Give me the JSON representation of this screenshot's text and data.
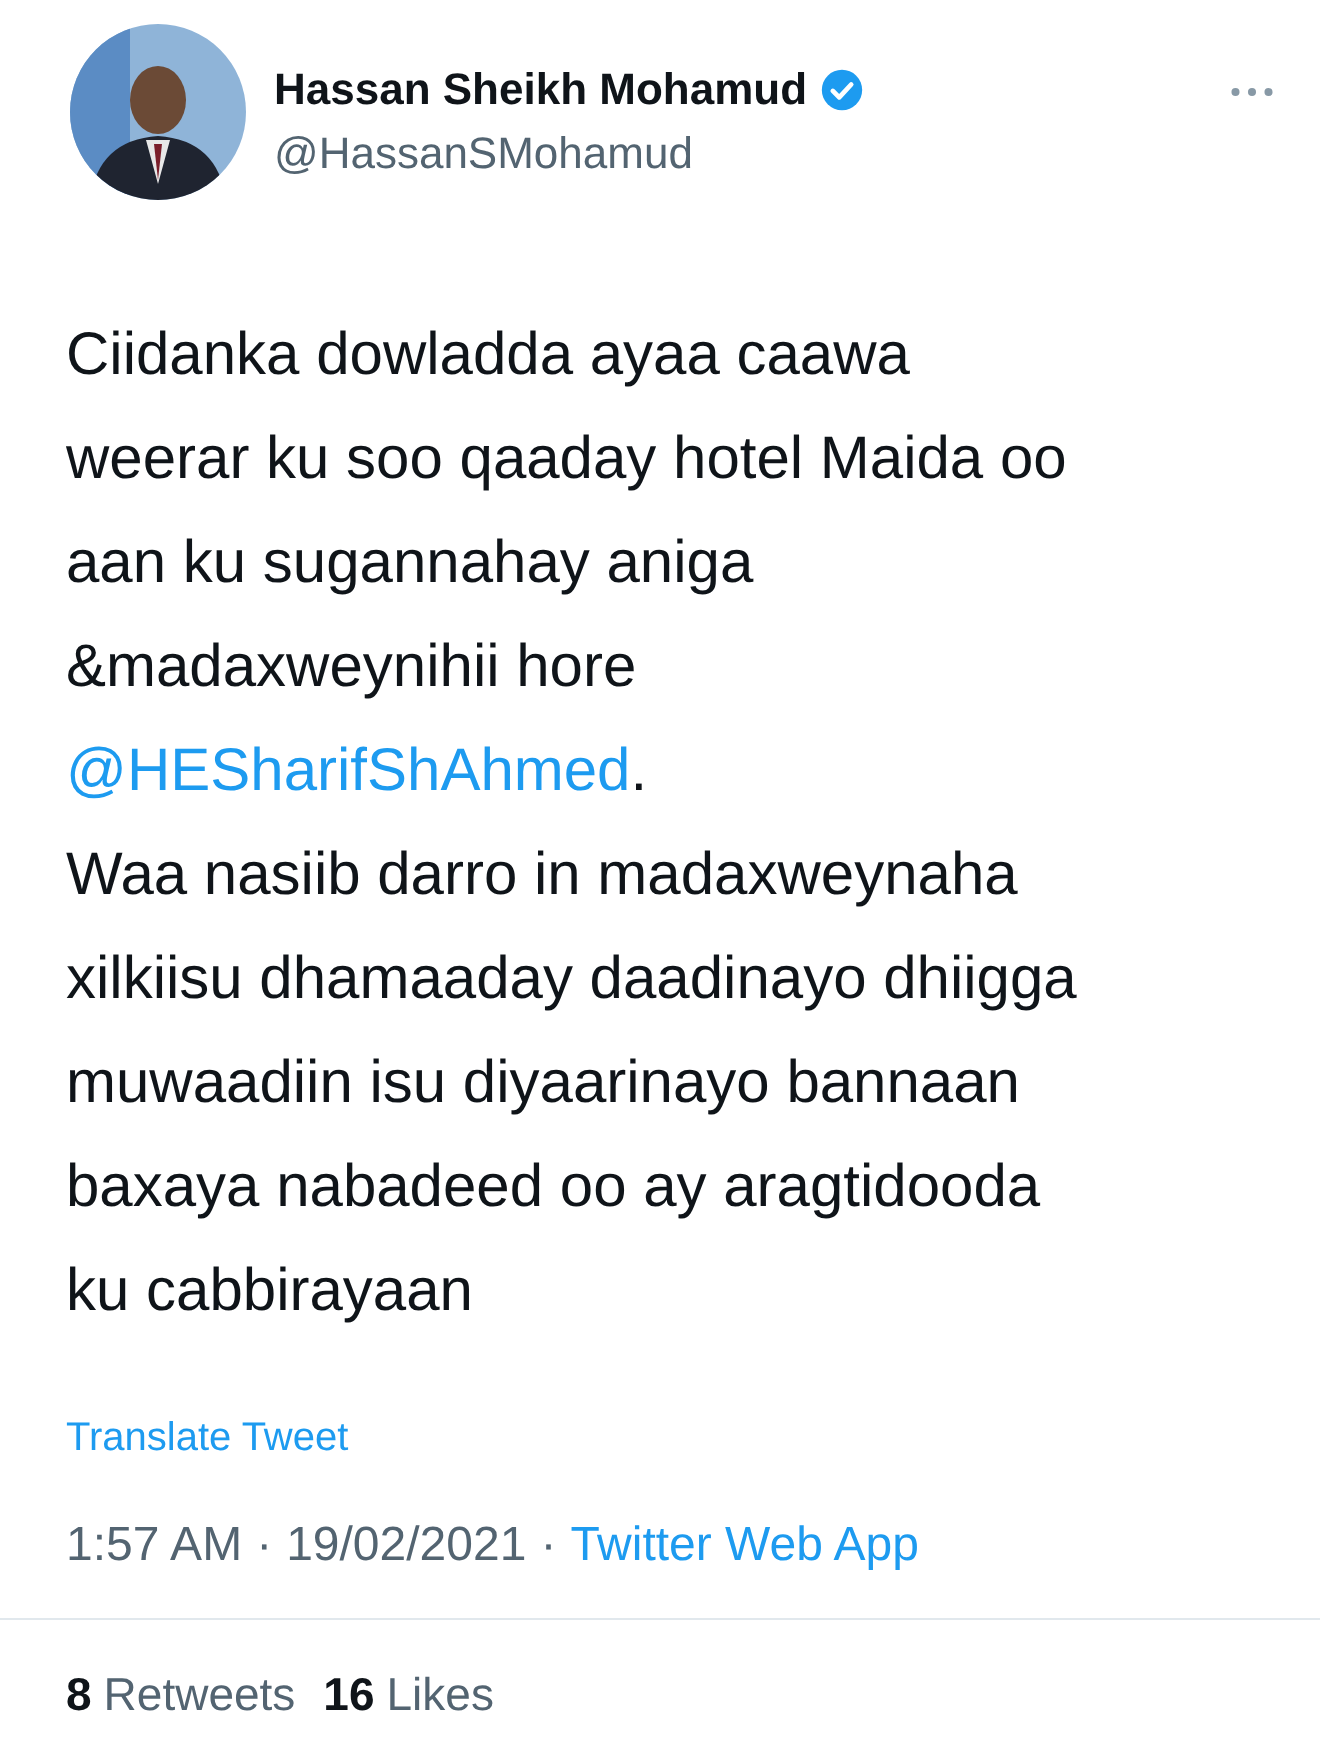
{
  "author": {
    "name": "Hassan Sheikh Mohamud",
    "handle": "@HassanSMohamud",
    "verified": true
  },
  "body": [
    {
      "kind": "text",
      "text": "Ciidanka dowladda ayaa caawa\nweerar ku soo qaaday hotel Maida oo\naan ku sugannahay aniga\n&madaxweynihii hore\n"
    },
    {
      "kind": "mention",
      "text": "@HESharifShAhmed"
    },
    {
      "kind": "text",
      "text": ".\nWaa nasiib darro in madaxweynaha\nxilkiisu dhamaaday daadinayo dhiigga\nmuwaadiin isu diyaarinayo bannaan\nbaxaya nabadeed oo ay aragtidooda\nku cabbirayaan"
    }
  ],
  "translate": "Translate Tweet",
  "meta": [
    {
      "kind": "text",
      "text": "1:57 AM"
    },
    {
      "kind": "separator",
      "text": "·"
    },
    {
      "kind": "text",
      "text": "19/02/2021"
    },
    {
      "kind": "separator",
      "text": "·"
    },
    {
      "kind": "link",
      "text": "Twitter Web App"
    }
  ],
  "stats": [
    {
      "count": "8",
      "label": "Retweets"
    },
    {
      "count": "16",
      "label": "Likes"
    }
  ]
}
